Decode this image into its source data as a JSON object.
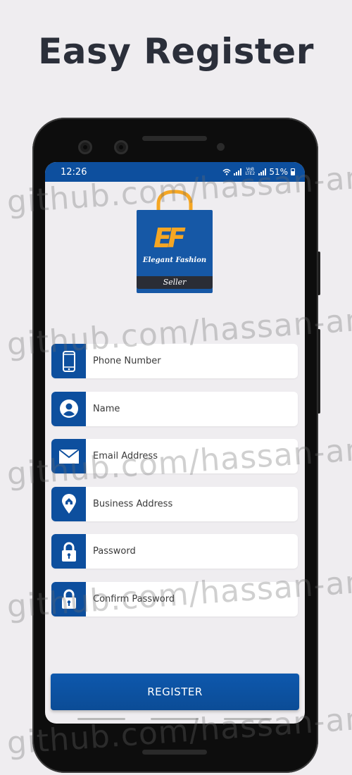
{
  "promo": {
    "title": "Easy Register"
  },
  "status_bar": {
    "time": "12:26",
    "network": "VoB LTE2",
    "battery": "51%"
  },
  "logo": {
    "brand_name": "Elegant Fashion",
    "tagline": "Seller",
    "mark": "EF"
  },
  "form": {
    "fields": [
      {
        "placeholder": "Phone Number",
        "icon": "phone-icon"
      },
      {
        "placeholder": "Name",
        "icon": "person-icon"
      },
      {
        "placeholder": "Email Address",
        "icon": "mail-icon"
      },
      {
        "placeholder": "Business Address",
        "icon": "location-pin-icon"
      },
      {
        "placeholder": "Password",
        "icon": "lock-icon"
      },
      {
        "placeholder": "Confirm Password",
        "icon": "lock-icon"
      }
    ],
    "register_label": "REGISTER"
  },
  "watermark": {
    "text": "github.com/hassan-amr"
  },
  "colors": {
    "primary": "#0d4f9e",
    "accent": "#f5a623",
    "background": "#efedf0"
  }
}
